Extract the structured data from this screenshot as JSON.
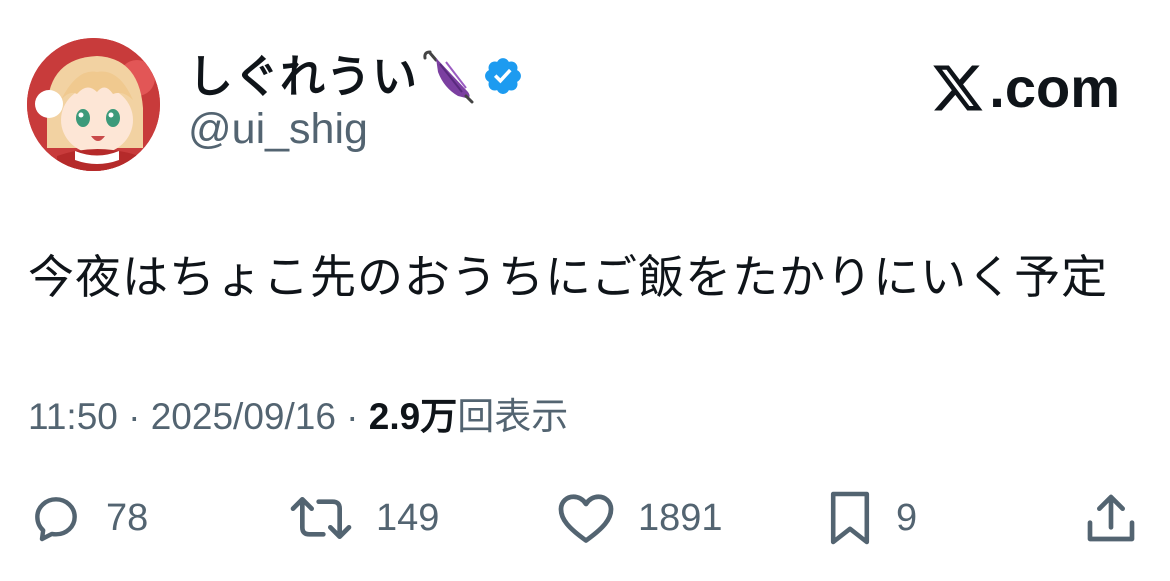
{
  "author": {
    "display_name": "しぐれうい",
    "handle": "@ui_shig",
    "verified": true,
    "name_emoji": "closed-umbrella-icon"
  },
  "brand": {
    "label": ".com",
    "logo": "x-logo-icon"
  },
  "tweet": {
    "text": "今夜はちょこ先のおうちにご飯をたかりにいく予定"
  },
  "meta": {
    "time_and_date": "11:50 · 2025/09/16 · ",
    "views_count": "2.9万",
    "views_label": "回表示"
  },
  "actions": {
    "reply": {
      "icon": "reply-icon",
      "count": "78"
    },
    "retweet": {
      "icon": "retweet-icon",
      "count": "149"
    },
    "like": {
      "icon": "heart-icon",
      "count": "1891"
    },
    "bookmark": {
      "icon": "bookmark-icon",
      "count": "9"
    },
    "share": {
      "icon": "share-icon"
    }
  },
  "colors": {
    "text_primary": "#0f1419",
    "text_secondary": "#536471",
    "verified_blue": "#1d9bf0",
    "umbrella_purple": "#7b3fa0"
  }
}
